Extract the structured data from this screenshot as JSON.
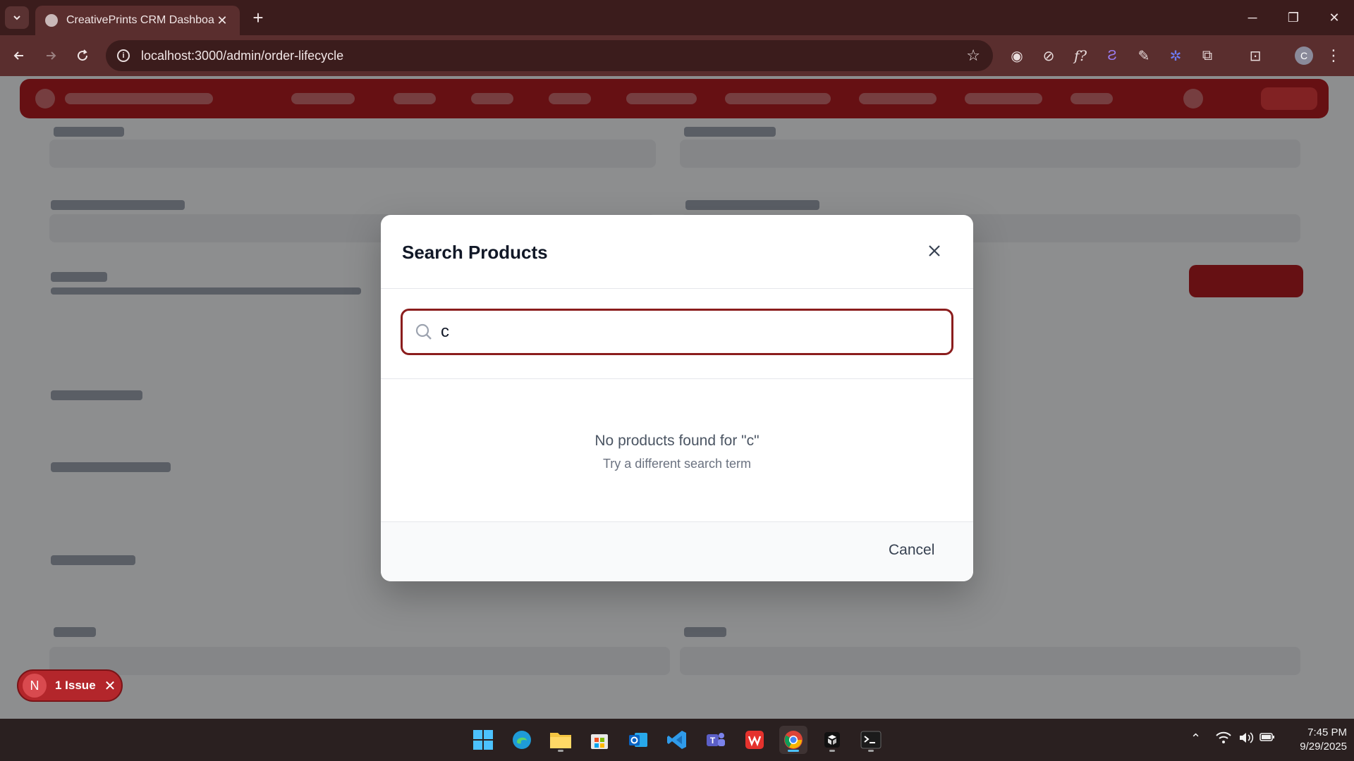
{
  "browser": {
    "tab_title": "CreativePrints CRM Dashboard",
    "url": "localhost:3000/admin/order-lifecycle",
    "profile_initial": "C"
  },
  "modal": {
    "title": "Search Products",
    "search_value": "c",
    "empty_message": "No products found for \"c\"",
    "empty_hint": "Try a different search term",
    "cancel_label": "Cancel"
  },
  "issue_toast": {
    "badge": "N",
    "label": "1 Issue"
  },
  "taskbar": {
    "time": "7:45 PM",
    "date": "9/29/2025"
  },
  "colors": {
    "brand": "#b01c22",
    "focus_ring": "#8b1d1d",
    "chrome": "#3b1c1c"
  }
}
